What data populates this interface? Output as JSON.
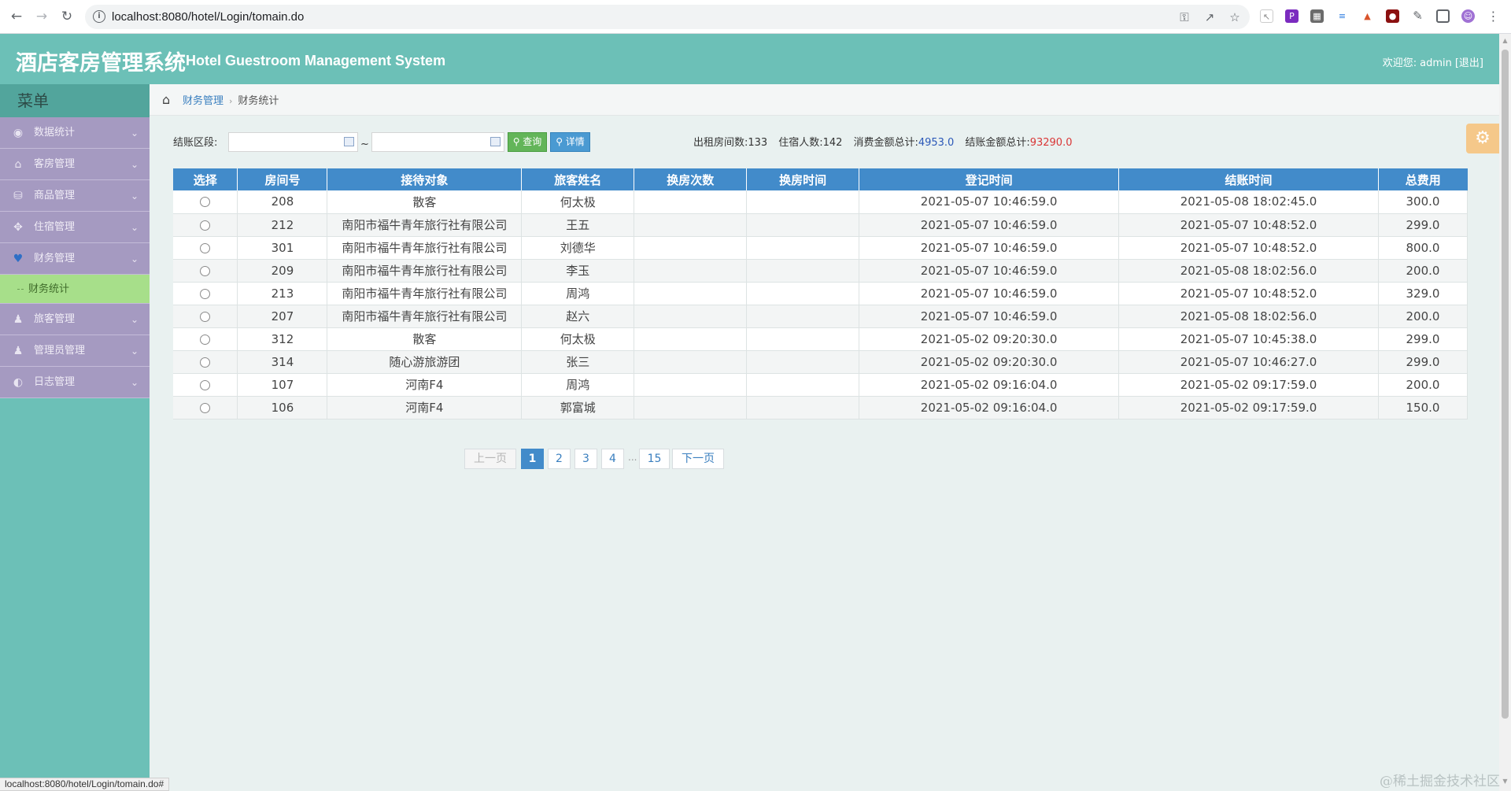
{
  "browser": {
    "url": "localhost:8080/hotel/Login/tomain.do",
    "status_url": "localhost:8080/hotel/Login/tomain.do#"
  },
  "header": {
    "title_cn": "酒店客房管理系统",
    "title_en": "Hotel Guestroom Management System",
    "welcome_label": "欢迎您:",
    "username": "admin",
    "logout_label": "[退出]"
  },
  "sidebar": {
    "title": "菜单",
    "items": [
      {
        "label": "数据统计",
        "icon": "dashboard-icon"
      },
      {
        "label": "客房管理",
        "icon": "home-icon"
      },
      {
        "label": "商品管理",
        "icon": "database-icon"
      },
      {
        "label": "住宿管理",
        "icon": "move-icon"
      },
      {
        "label": "财务管理",
        "icon": "heart-icon",
        "active": true
      },
      {
        "label": "旅客管理",
        "icon": "user-icon"
      },
      {
        "label": "管理员管理",
        "icon": "user-icon"
      },
      {
        "label": "日志管理",
        "icon": "adjust-icon"
      }
    ],
    "subitem": "财务统计"
  },
  "breadcrumb": {
    "parent": "财务管理",
    "current": "财务统计"
  },
  "filter": {
    "label": "结账区段:",
    "start_value": "",
    "end_value": "",
    "separator": "~",
    "search_label": "查询",
    "detail_label": "详情"
  },
  "stats": {
    "rooms_label": "出租房间数:",
    "rooms_value": "133",
    "guests_label": "住宿人数:",
    "guests_value": "142",
    "consume_label": "消费金额总计:",
    "consume_value": "4953.0",
    "checkout_label": "结账金额总计:",
    "checkout_value": "93290.0"
  },
  "colors": {
    "header_bg": "#6cc0b7",
    "menu_bg": "#a59ac1",
    "submenu_bg": "#a7df8a",
    "table_header": "#428bca",
    "stat_blue": "#2b58b8",
    "stat_red": "#d93636"
  },
  "table": {
    "columns": [
      "选择",
      "房间号",
      "接待对象",
      "旅客姓名",
      "换房次数",
      "换房时间",
      "登记时间",
      "结账时间",
      "总费用"
    ],
    "rows": [
      [
        "",
        "208",
        "散客",
        "何太极",
        "",
        "",
        "2021-05-07 10:46:59.0",
        "2021-05-08 18:02:45.0",
        "300.0"
      ],
      [
        "",
        "212",
        "南阳市福牛青年旅行社有限公司",
        "王五",
        "",
        "",
        "2021-05-07 10:46:59.0",
        "2021-05-07 10:48:52.0",
        "299.0"
      ],
      [
        "",
        "301",
        "南阳市福牛青年旅行社有限公司",
        "刘德华",
        "",
        "",
        "2021-05-07 10:46:59.0",
        "2021-05-07 10:48:52.0",
        "800.0"
      ],
      [
        "",
        "209",
        "南阳市福牛青年旅行社有限公司",
        "李玉",
        "",
        "",
        "2021-05-07 10:46:59.0",
        "2021-05-08 18:02:56.0",
        "200.0"
      ],
      [
        "",
        "213",
        "南阳市福牛青年旅行社有限公司",
        "周鸿",
        "",
        "",
        "2021-05-07 10:46:59.0",
        "2021-05-07 10:48:52.0",
        "329.0"
      ],
      [
        "",
        "207",
        "南阳市福牛青年旅行社有限公司",
        "赵六",
        "",
        "",
        "2021-05-07 10:46:59.0",
        "2021-05-08 18:02:56.0",
        "200.0"
      ],
      [
        "",
        "312",
        "散客",
        "何太极",
        "",
        "",
        "2021-05-02 09:20:30.0",
        "2021-05-07 10:45:38.0",
        "299.0"
      ],
      [
        "",
        "314",
        "随心游旅游团",
        "张三",
        "",
        "",
        "2021-05-02 09:20:30.0",
        "2021-05-07 10:46:27.0",
        "299.0"
      ],
      [
        "",
        "107",
        "河南F4",
        "周鸿",
        "",
        "",
        "2021-05-02 09:16:04.0",
        "2021-05-02 09:17:59.0",
        "200.0"
      ],
      [
        "",
        "106",
        "河南F4",
        "郭富城",
        "",
        "",
        "2021-05-02 09:16:04.0",
        "2021-05-02 09:17:59.0",
        "150.0"
      ]
    ]
  },
  "pagination": {
    "prev_label": "上一页",
    "pages": [
      "1",
      "2",
      "3",
      "4"
    ],
    "ellipsis": "...",
    "last_page": "15",
    "next_label": "下一页",
    "current": "1"
  },
  "watermark": "@稀土掘金技术社区"
}
